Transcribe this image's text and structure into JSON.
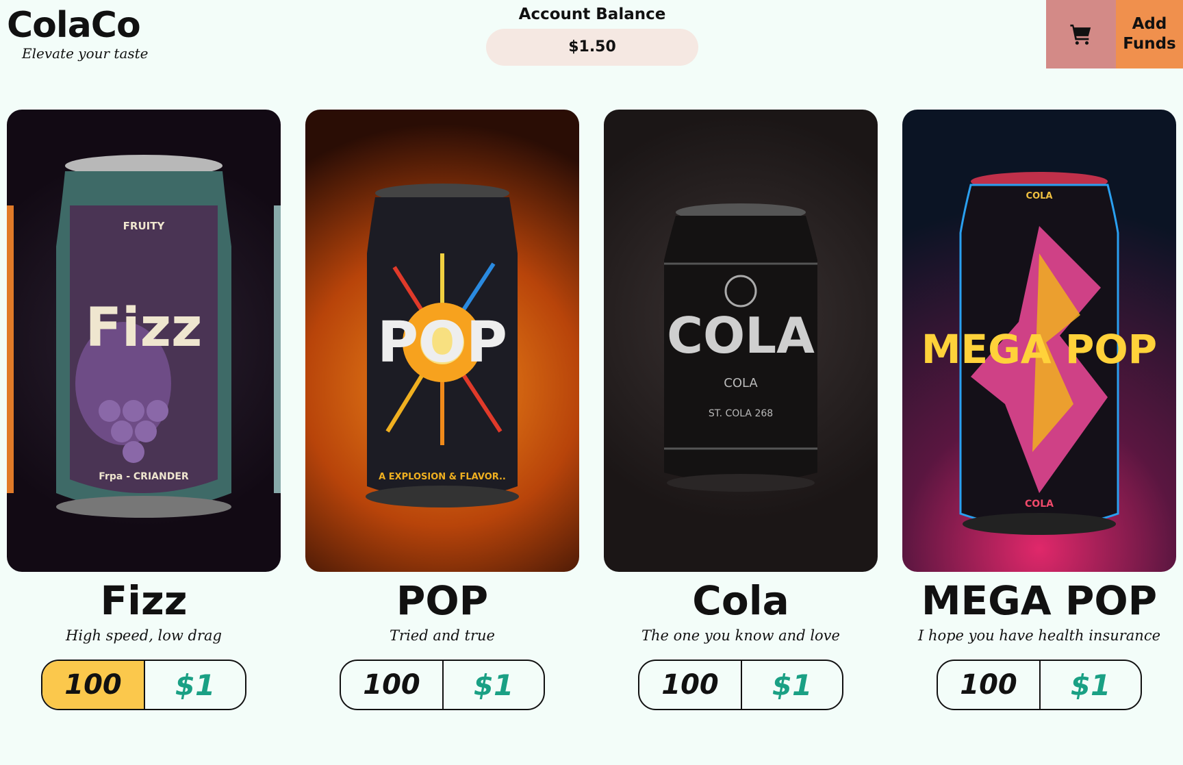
{
  "header": {
    "brand": "ColaCo",
    "tagline": "Elevate your taste",
    "balance_label": "Account Balance",
    "balance_value": "$1.50",
    "add_funds_line1": "Add",
    "add_funds_line2": "Funds",
    "cart_icon": "cart-icon"
  },
  "products": [
    {
      "name": "Fizz",
      "description": "High speed, low drag",
      "quantity": "100",
      "price": "$1",
      "can_text": "Fizz",
      "can_top": "FRUITY",
      "can_bottom": "Frpa - CRIANDER"
    },
    {
      "name": "POP",
      "description": "Tried and true",
      "quantity": "100",
      "price": "$1",
      "can_text": "POP",
      "can_top": "",
      "can_bottom": "A EXPLOSION & FLAVOR.."
    },
    {
      "name": "Cola",
      "description": "The one you know and love",
      "quantity": "100",
      "price": "$1",
      "can_text": "COLA",
      "can_top": "COLA",
      "can_bottom": "ST. COLA 268"
    },
    {
      "name": "MEGA POP",
      "description": "I hope you have health insurance",
      "quantity": "100",
      "price": "$1",
      "can_text": "MEGA POP",
      "can_top": "COLA",
      "can_bottom": "COLA"
    }
  ],
  "colors": {
    "background": "#f3fdf9",
    "cart_button": "#d38a87",
    "add_funds_button": "#f0904d",
    "selected_quantity": "#fbc84c",
    "price_text": "#1aa084"
  }
}
